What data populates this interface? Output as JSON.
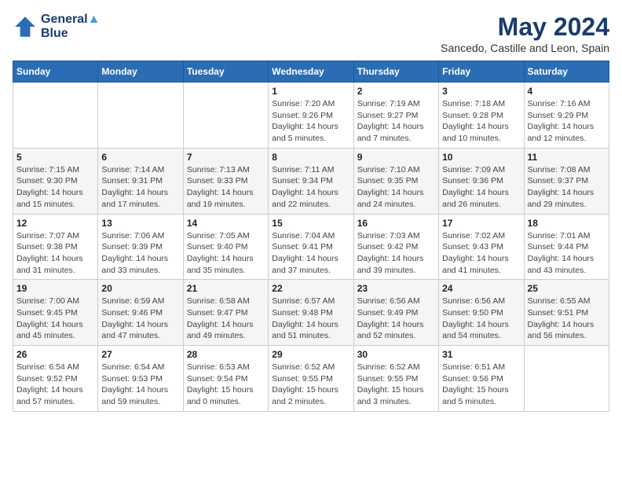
{
  "header": {
    "logo_line1": "General",
    "logo_line2": "Blue",
    "title": "May 2024",
    "subtitle": "Sancedo, Castille and Leon, Spain"
  },
  "calendar": {
    "days_of_week": [
      "Sunday",
      "Monday",
      "Tuesday",
      "Wednesday",
      "Thursday",
      "Friday",
      "Saturday"
    ],
    "weeks": [
      [
        {
          "day": "",
          "info": ""
        },
        {
          "day": "",
          "info": ""
        },
        {
          "day": "",
          "info": ""
        },
        {
          "day": "1",
          "info": "Sunrise: 7:20 AM\nSunset: 9:26 PM\nDaylight: 14 hours\nand 5 minutes."
        },
        {
          "day": "2",
          "info": "Sunrise: 7:19 AM\nSunset: 9:27 PM\nDaylight: 14 hours\nand 7 minutes."
        },
        {
          "day": "3",
          "info": "Sunrise: 7:18 AM\nSunset: 9:28 PM\nDaylight: 14 hours\nand 10 minutes."
        },
        {
          "day": "4",
          "info": "Sunrise: 7:16 AM\nSunset: 9:29 PM\nDaylight: 14 hours\nand 12 minutes."
        }
      ],
      [
        {
          "day": "5",
          "info": "Sunrise: 7:15 AM\nSunset: 9:30 PM\nDaylight: 14 hours\nand 15 minutes."
        },
        {
          "day": "6",
          "info": "Sunrise: 7:14 AM\nSunset: 9:31 PM\nDaylight: 14 hours\nand 17 minutes."
        },
        {
          "day": "7",
          "info": "Sunrise: 7:13 AM\nSunset: 9:33 PM\nDaylight: 14 hours\nand 19 minutes."
        },
        {
          "day": "8",
          "info": "Sunrise: 7:11 AM\nSunset: 9:34 PM\nDaylight: 14 hours\nand 22 minutes."
        },
        {
          "day": "9",
          "info": "Sunrise: 7:10 AM\nSunset: 9:35 PM\nDaylight: 14 hours\nand 24 minutes."
        },
        {
          "day": "10",
          "info": "Sunrise: 7:09 AM\nSunset: 9:36 PM\nDaylight: 14 hours\nand 26 minutes."
        },
        {
          "day": "11",
          "info": "Sunrise: 7:08 AM\nSunset: 9:37 PM\nDaylight: 14 hours\nand 29 minutes."
        }
      ],
      [
        {
          "day": "12",
          "info": "Sunrise: 7:07 AM\nSunset: 9:38 PM\nDaylight: 14 hours\nand 31 minutes."
        },
        {
          "day": "13",
          "info": "Sunrise: 7:06 AM\nSunset: 9:39 PM\nDaylight: 14 hours\nand 33 minutes."
        },
        {
          "day": "14",
          "info": "Sunrise: 7:05 AM\nSunset: 9:40 PM\nDaylight: 14 hours\nand 35 minutes."
        },
        {
          "day": "15",
          "info": "Sunrise: 7:04 AM\nSunset: 9:41 PM\nDaylight: 14 hours\nand 37 minutes."
        },
        {
          "day": "16",
          "info": "Sunrise: 7:03 AM\nSunset: 9:42 PM\nDaylight: 14 hours\nand 39 minutes."
        },
        {
          "day": "17",
          "info": "Sunrise: 7:02 AM\nSunset: 9:43 PM\nDaylight: 14 hours\nand 41 minutes."
        },
        {
          "day": "18",
          "info": "Sunrise: 7:01 AM\nSunset: 9:44 PM\nDaylight: 14 hours\nand 43 minutes."
        }
      ],
      [
        {
          "day": "19",
          "info": "Sunrise: 7:00 AM\nSunset: 9:45 PM\nDaylight: 14 hours\nand 45 minutes."
        },
        {
          "day": "20",
          "info": "Sunrise: 6:59 AM\nSunset: 9:46 PM\nDaylight: 14 hours\nand 47 minutes."
        },
        {
          "day": "21",
          "info": "Sunrise: 6:58 AM\nSunset: 9:47 PM\nDaylight: 14 hours\nand 49 minutes."
        },
        {
          "day": "22",
          "info": "Sunrise: 6:57 AM\nSunset: 9:48 PM\nDaylight: 14 hours\nand 51 minutes."
        },
        {
          "day": "23",
          "info": "Sunrise: 6:56 AM\nSunset: 9:49 PM\nDaylight: 14 hours\nand 52 minutes."
        },
        {
          "day": "24",
          "info": "Sunrise: 6:56 AM\nSunset: 9:50 PM\nDaylight: 14 hours\nand 54 minutes."
        },
        {
          "day": "25",
          "info": "Sunrise: 6:55 AM\nSunset: 9:51 PM\nDaylight: 14 hours\nand 56 minutes."
        }
      ],
      [
        {
          "day": "26",
          "info": "Sunrise: 6:54 AM\nSunset: 9:52 PM\nDaylight: 14 hours\nand 57 minutes."
        },
        {
          "day": "27",
          "info": "Sunrise: 6:54 AM\nSunset: 9:53 PM\nDaylight: 14 hours\nand 59 minutes."
        },
        {
          "day": "28",
          "info": "Sunrise: 6:53 AM\nSunset: 9:54 PM\nDaylight: 15 hours\nand 0 minutes."
        },
        {
          "day": "29",
          "info": "Sunrise: 6:52 AM\nSunset: 9:55 PM\nDaylight: 15 hours\nand 2 minutes."
        },
        {
          "day": "30",
          "info": "Sunrise: 6:52 AM\nSunset: 9:55 PM\nDaylight: 15 hours\nand 3 minutes."
        },
        {
          "day": "31",
          "info": "Sunrise: 6:51 AM\nSunset: 9:56 PM\nDaylight: 15 hours\nand 5 minutes."
        },
        {
          "day": "",
          "info": ""
        }
      ]
    ]
  }
}
